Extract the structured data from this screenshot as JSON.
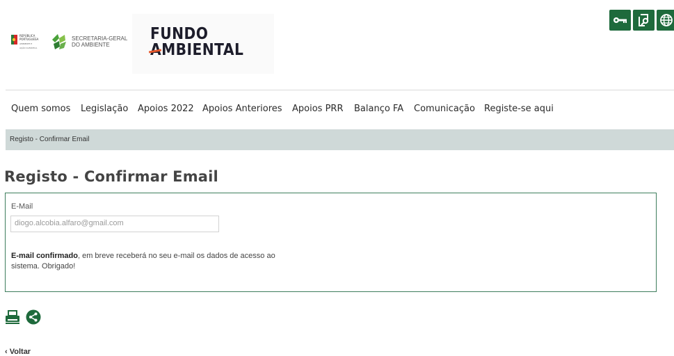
{
  "header": {
    "gov_logo_lines": [
      "REPÚBLICA",
      "PORTUGUESA"
    ],
    "gov_logo_small": [
      "AMBIENTE E",
      "AÇÃO CLIMÁTICA"
    ],
    "agency_lines": [
      "SECRETARIA-GERAL",
      "DO AMBIENTE"
    ],
    "brand_line1": "FUNDO",
    "brand_line2": "AMBIENTAL",
    "brand_color": "#1d1d2b",
    "accent_color": "#e7572a",
    "utility_icons": [
      "key-icon",
      "search-document-icon",
      "globe-icon"
    ],
    "utility_color": "#1e6a3c"
  },
  "nav": {
    "items": [
      "Quem somos",
      "Legislação",
      "Apoios 2022",
      "Apoios Anteriores",
      "Apoios PRR",
      "Balanço FA",
      "Comunicação",
      "Registe-se aqui"
    ]
  },
  "breadcrumb": {
    "current": "Registo - Confirmar Email"
  },
  "page": {
    "title": "Registo - Confirmar Email"
  },
  "form": {
    "email_label": "E-Mail",
    "email_value": "diogo.alcobia.alfaro@gmail.com",
    "message_bold": "E-mail confirmado",
    "message_rest": ", em breve receberá no seu e-mail os dados de acesso ao sistema. Obrigado!",
    "border_color": "#3d7d5c"
  },
  "tools": {
    "icons": [
      "print-icon",
      "share-icon"
    ]
  },
  "back": {
    "label": "Voltar"
  }
}
